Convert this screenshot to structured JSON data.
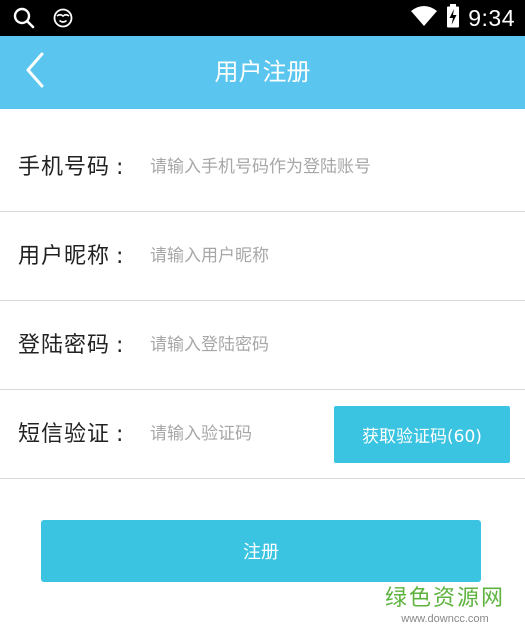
{
  "status_bar": {
    "time": "9:34",
    "icons": [
      "search-icon",
      "emoji-face-icon",
      "wifi-icon",
      "battery-charging-icon"
    ]
  },
  "header": {
    "title": "用户注册",
    "back_icon": "chevron-left-icon",
    "background_color": "#5ac5ee"
  },
  "form": {
    "rows": [
      {
        "label": "手机号码",
        "colon": ":",
        "placeholder": "请输入手机号码作为登陆账号",
        "value": ""
      },
      {
        "label": "用户昵称",
        "colon": ":",
        "placeholder": "请输入用户昵称",
        "value": ""
      },
      {
        "label": "登陆密码",
        "colon": ":",
        "placeholder": "请输入登陆密码",
        "value": ""
      },
      {
        "label": "短信验证",
        "colon": ":",
        "placeholder": "请输入验证码",
        "value": ""
      }
    ],
    "get_code_button": "获取验证码(60)",
    "button_color": "#3bc4e1"
  },
  "register_button": "注册",
  "watermark": {
    "text": "绿色资源网",
    "url": "www.downcc.com"
  }
}
